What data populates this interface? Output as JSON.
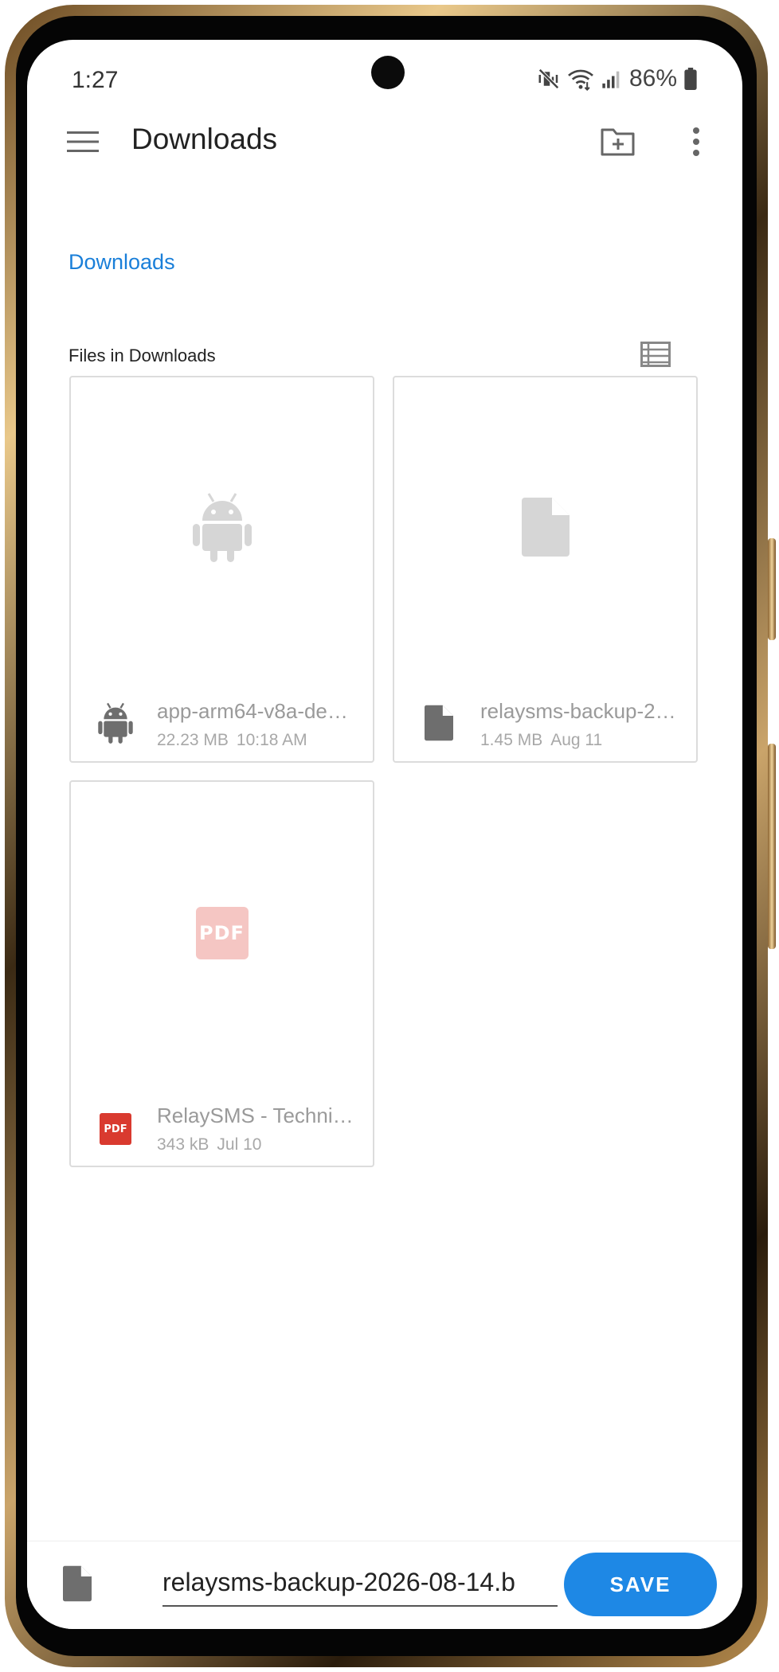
{
  "status_bar": {
    "time": "1:27",
    "battery": "86%",
    "icons": [
      "vibrate-mute-icon",
      "wifi-icon",
      "signal-icon",
      "battery-icon"
    ]
  },
  "app_bar": {
    "title": "Downloads",
    "icons": [
      "menu-icon",
      "new-folder-icon",
      "more-vert-icon"
    ]
  },
  "breadcrumb": {
    "label": "Downloads"
  },
  "section": {
    "header": "Files in Downloads",
    "view_icon": "list-view-icon"
  },
  "files": [
    {
      "name": "app-arm64-v8a-de…",
      "size": "22.23 MB",
      "date": "10:18 AM",
      "icon": "android-icon"
    },
    {
      "name": "relaysms-backup-2…",
      "size": "1.45 MB",
      "date": "Aug 11",
      "icon": "file-icon"
    },
    {
      "name": "RelaySMS - Techni…",
      "size": "343 kB",
      "date": "Jul 10",
      "icon": "pdf-icon",
      "pdf_label": "PDF"
    }
  ],
  "bottom_bar": {
    "filename": "relaysms-backup-2026-08-14.b",
    "save_label": "SAVE"
  },
  "colors": {
    "accent": "#1e88e5",
    "breadcrumb": "#1a7fd9",
    "pdf_red": "#d93a2f"
  }
}
